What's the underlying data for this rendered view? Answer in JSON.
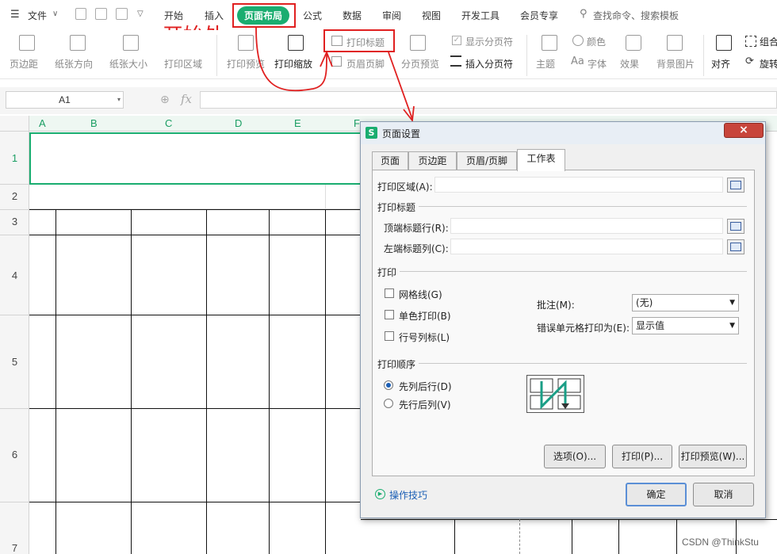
{
  "toolbar": {
    "file_menu": "文件",
    "tabs": [
      "开始",
      "插入",
      "页面布局",
      "公式",
      "数据",
      "审阅",
      "视图",
      "开发工具",
      "会员专享"
    ],
    "search_placeholder": "查找命令、搜索模板"
  },
  "annotation": {
    "start_label": "开始处",
    "color": "#e02020"
  },
  "ribbon": {
    "margins": "页边距",
    "orientation": "纸张方向",
    "size": "纸张大小",
    "print_area": "打印区域",
    "print_preview": "打印预览",
    "print_scale": "打印缩放",
    "print_titles": "打印标题",
    "header_footer": "页眉页脚",
    "page_break_preview": "分页预览",
    "show_page_breaks": "显示分页符",
    "insert_page_break": "插入分页符",
    "theme": "主题",
    "colors": "颜色",
    "fonts": "字体",
    "effects": "效果",
    "background": "背景图片",
    "align": "对齐",
    "group": "组合",
    "rotate": "旋转"
  },
  "formula_bar": {
    "cell_ref": "A1",
    "fx": "fx"
  },
  "grid": {
    "columns": [
      "A",
      "B",
      "C",
      "D",
      "E",
      "F"
    ],
    "rows": [
      "1",
      "2",
      "3",
      "4",
      "5",
      "6",
      "7"
    ]
  },
  "dialog": {
    "title": "页面设置",
    "close": "×",
    "tabs": [
      "页面",
      "页边距",
      "页眉/页脚",
      "工作表"
    ],
    "print_area_label": "打印区域(A):",
    "print_titles_section": "打印标题",
    "top_rows_label": "顶端标题行(R):",
    "left_cols_label": "左端标题列(C):",
    "print_section": "打印",
    "gridlines": "网格线(G)",
    "black_white": "单色打印(B)",
    "row_col_headings": "行号列标(L)",
    "comments_label": "批注(M):",
    "comments_value": "(无)",
    "cell_errors_label": "错误单元格打印为(E):",
    "cell_errors_value": "显示值",
    "page_order_section": "打印顺序",
    "down_then_over": "先列后行(D)",
    "over_then_down": "先行后列(V)",
    "options_button": "选项(O)...",
    "print_button": "打印(P)...",
    "preview_button": "打印预览(W)...",
    "tips_link": "操作技巧",
    "ok_button": "确定",
    "cancel_button": "取消"
  },
  "watermark": "CSDN @ThinkStu",
  "colors": {
    "accent": "#1aad70",
    "annotation": "#e02020",
    "dialog_link": "#1b5fb5"
  }
}
